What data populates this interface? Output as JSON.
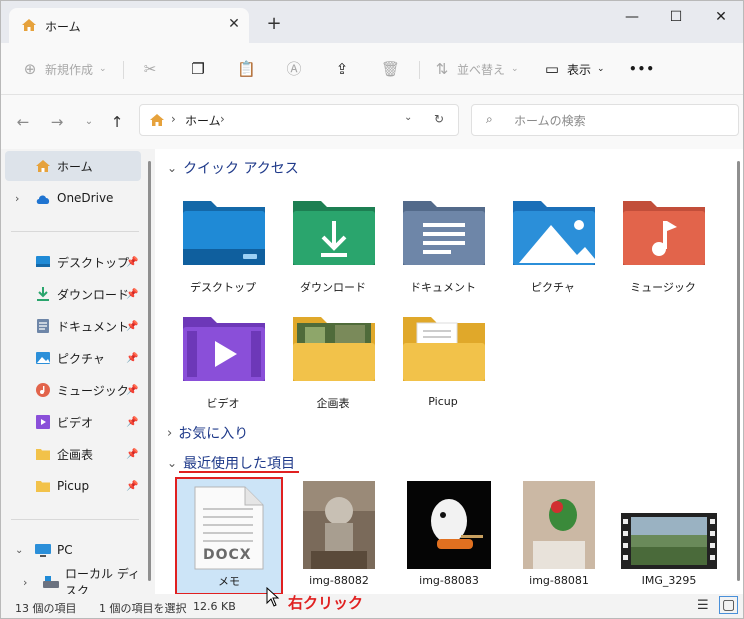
{
  "tab": {
    "title": "ホーム",
    "new_tab": "+"
  },
  "window_controls": {
    "minimize": "—",
    "maximize": "☐",
    "close": "✕"
  },
  "toolbar": {
    "new_label": "新規作成",
    "sort_label": "並べ替え",
    "view_label": "表示",
    "more_label": "•••"
  },
  "address": {
    "segment": "ホーム",
    "separator": "›"
  },
  "search": {
    "placeholder": "ホームの検索"
  },
  "sidebar": {
    "home": "ホーム",
    "onedrive": "OneDrive",
    "pinned": [
      {
        "label": "デスクトップ",
        "icon": "desktop-icon"
      },
      {
        "label": "ダウンロード",
        "icon": "download-icon"
      },
      {
        "label": "ドキュメント",
        "icon": "document-icon"
      },
      {
        "label": "ピクチャ",
        "icon": "picture-icon"
      },
      {
        "label": "ミュージック",
        "icon": "music-icon"
      },
      {
        "label": "ビデオ",
        "icon": "video-icon"
      },
      {
        "label": "企画表",
        "icon": "folder-icon"
      },
      {
        "label": "Picup",
        "icon": "folder-icon"
      }
    ],
    "pc": "PC",
    "local_disk": "ローカル ディスク"
  },
  "quick_access": {
    "heading": "クイック アクセス",
    "items": [
      {
        "label": "デスクトップ",
        "icon": "desktop-folder-icon",
        "color": "#1f8ad6"
      },
      {
        "label": "ダウンロード",
        "icon": "download-folder-icon",
        "color": "#2aa56d"
      },
      {
        "label": "ドキュメント",
        "icon": "documents-folder-icon",
        "color": "#6e86a8"
      },
      {
        "label": "ピクチャ",
        "icon": "pictures-folder-icon",
        "color": "#2b8fd9"
      },
      {
        "label": "ミュージック",
        "icon": "music-folder-icon",
        "color": "#e2644b"
      },
      {
        "label": "ビデオ",
        "icon": "videos-folder-icon",
        "color": "#8a4fd9"
      },
      {
        "label": "企画表",
        "icon": "folder-with-photo-icon",
        "color": "#f2c24a"
      },
      {
        "label": "Picup",
        "icon": "folder-with-files-icon",
        "color": "#f2c24a"
      }
    ]
  },
  "favorites": {
    "heading": "お気に入り"
  },
  "recent": {
    "heading": "最近使用した項目",
    "items": [
      {
        "label": "メモ",
        "type": "DOCX"
      },
      {
        "label": "img-88082"
      },
      {
        "label": "img-88083"
      },
      {
        "label": "img-88081"
      },
      {
        "label": "IMG_3295"
      }
    ]
  },
  "status": {
    "count": "13 個の項目",
    "selected": "1 個の項目を選択",
    "size": "12.6 KB"
  },
  "annotation": {
    "right_click": "右クリック",
    "color": "#e02020"
  }
}
